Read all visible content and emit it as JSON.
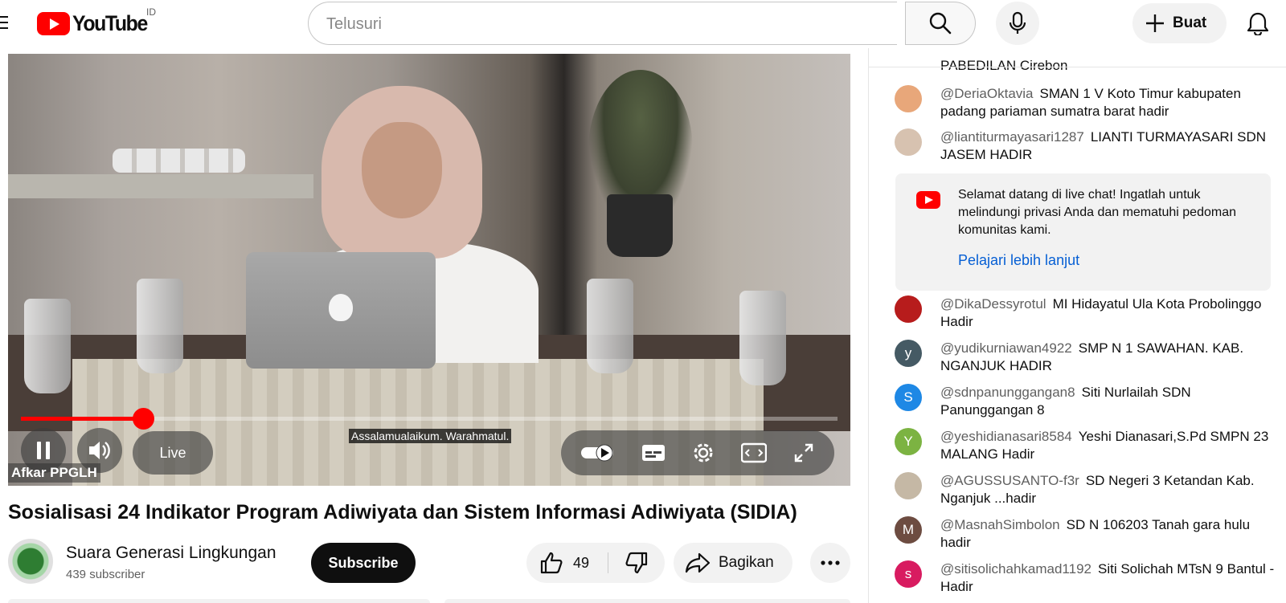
{
  "header": {
    "logo_text": "YouTube",
    "country": "ID",
    "search_placeholder": "Telusuri",
    "create_label": "Buat"
  },
  "player": {
    "caption": "Assalamualaikum. Warahmatul.",
    "live_label": "Live",
    "channel_watermark": "Afkar PPGLH",
    "progress": 0.15
  },
  "video": {
    "title": "Sosialisasi 24 Indikator Program Adiwiyata dan Sistem Informasi Adiwiyata (SIDIA)",
    "channel_name": "Suara Generasi Lingkungan",
    "subscribers": "439 subscriber",
    "subscribe_label": "Subscribe",
    "likes": "49",
    "share_label": "Bagikan"
  },
  "chat": {
    "cut_off_text": "PABEDILAN Cirebon",
    "notice": {
      "text": "Selamat datang di live chat! Ingatlah untuk melindungi privasi Anda dan mematuhi pedoman komunitas kami.",
      "link": "Pelajari lebih lanjut"
    },
    "messages": [
      {
        "author": "@DeriaOktavia",
        "text": "SMAN 1 V Koto Timur kabupaten padang pariaman sumatra barat hadir",
        "avatar": "",
        "color": "#e8a77a"
      },
      {
        "author": "@liantiturmayasari1287",
        "text": "LIANTI TURMAYASARI SDN JASEM HADIR",
        "avatar": "",
        "color": "#d7c2b0"
      },
      {
        "author": "@DikaDessyrotul",
        "text": "MI Hidayatul Ula Kota Probolinggo Hadir",
        "avatar": "",
        "color": "#b71c1c"
      },
      {
        "author": "@yudikurniawan4922",
        "text": "SMP N 1 SAWAHAN. KAB. NGANJUK HADIR",
        "avatar": "y",
        "color": "#455a64"
      },
      {
        "author": "@sdnpanunggangan8",
        "text": "Siti Nurlailah SDN Panunggangan 8",
        "avatar": "S",
        "color": "#1e88e5"
      },
      {
        "author": "@yeshidianasari8584",
        "text": "Yeshi Dianasari,S.Pd SMPN 23 MALANG Hadir",
        "avatar": "Y",
        "color": "#7cb342"
      },
      {
        "author": "@AGUSSUSANTO-f3r",
        "text": "SD Negeri 3 Ketandan Kab. Nganjuk ...hadir",
        "avatar": "",
        "color": "#c5b8a5"
      },
      {
        "author": "@MasnahSimbolon",
        "text": "SD N 106203 Tanah gara hulu hadir",
        "avatar": "M",
        "color": "#6d4c41"
      },
      {
        "author": "@sitisolichahkamad1192",
        "text": "Siti Solichah MTsN 9 Bantul -Hadir",
        "avatar": "s",
        "color": "#d81b60"
      }
    ]
  },
  "icons": [
    "menu-icon",
    "search-icon",
    "mic-icon",
    "plus-icon",
    "bell-icon",
    "pause-icon",
    "volume-icon",
    "autoplay-toggle-icon",
    "subtitles-icon",
    "settings-icon",
    "miniplayer-icon",
    "fullscreen-icon",
    "thumbs-up-icon",
    "thumbs-down-icon",
    "share-icon",
    "more-icon",
    "youtube-icon"
  ]
}
